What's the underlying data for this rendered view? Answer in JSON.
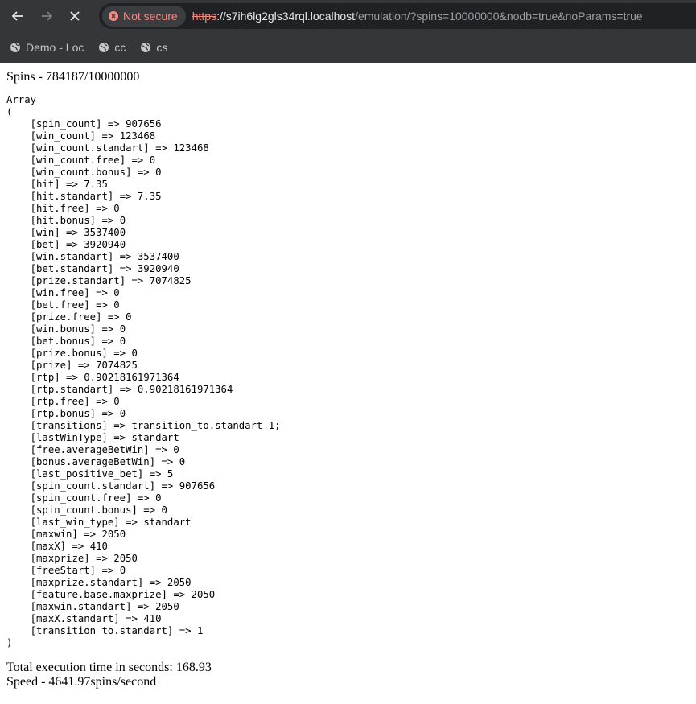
{
  "browser": {
    "security_label": "Not secure",
    "url_scheme": "https",
    "url_host": "://s7ih6lg2gls34rql.localhost",
    "url_path": "/emulation/?spins=10000000&nodb=true&noParams=true",
    "bookmarks": [
      {
        "label": "Demo - Loc",
        "icon": "globe-icon"
      },
      {
        "label": "cc",
        "icon": "globe-icon"
      },
      {
        "label": "cs",
        "icon": "globe-icon"
      }
    ]
  },
  "page": {
    "spins_line": "Spins - 784187/10000000",
    "array_open": "Array",
    "paren_open": "(",
    "entries": [
      {
        "key": "spin_count",
        "value": "907656"
      },
      {
        "key": "win_count",
        "value": "123468"
      },
      {
        "key": "win_count.standart",
        "value": "123468"
      },
      {
        "key": "win_count.free",
        "value": "0"
      },
      {
        "key": "win_count.bonus",
        "value": "0"
      },
      {
        "key": "hit",
        "value": "7.35"
      },
      {
        "key": "hit.standart",
        "value": "7.35"
      },
      {
        "key": "hit.free",
        "value": "0"
      },
      {
        "key": "hit.bonus",
        "value": "0"
      },
      {
        "key": "win",
        "value": "3537400"
      },
      {
        "key": "bet",
        "value": "3920940"
      },
      {
        "key": "win.standart",
        "value": "3537400"
      },
      {
        "key": "bet.standart",
        "value": "3920940"
      },
      {
        "key": "prize.standart",
        "value": "7074825"
      },
      {
        "key": "win.free",
        "value": "0"
      },
      {
        "key": "bet.free",
        "value": "0"
      },
      {
        "key": "prize.free",
        "value": "0"
      },
      {
        "key": "win.bonus",
        "value": "0"
      },
      {
        "key": "bet.bonus",
        "value": "0"
      },
      {
        "key": "prize.bonus",
        "value": "0"
      },
      {
        "key": "prize",
        "value": "7074825"
      },
      {
        "key": "rtp",
        "value": "0.90218161971364"
      },
      {
        "key": "rtp.standart",
        "value": "0.90218161971364"
      },
      {
        "key": "rtp.free",
        "value": "0"
      },
      {
        "key": "rtp.bonus",
        "value": "0"
      },
      {
        "key": "transitions",
        "value": "transition_to.standart-1;"
      },
      {
        "key": "lastWinType",
        "value": "standart"
      },
      {
        "key": "free.averageBetWin",
        "value": "0"
      },
      {
        "key": "bonus.averageBetWin",
        "value": "0"
      },
      {
        "key": "last_positive_bet",
        "value": "5"
      },
      {
        "key": "spin_count.standart",
        "value": "907656"
      },
      {
        "key": "spin_count.free",
        "value": "0"
      },
      {
        "key": "spin_count.bonus",
        "value": "0"
      },
      {
        "key": "last_win_type",
        "value": "standart"
      },
      {
        "key": "maxwin",
        "value": "2050"
      },
      {
        "key": "maxX",
        "value": "410"
      },
      {
        "key": "maxprize",
        "value": "2050"
      },
      {
        "key": "freeStart",
        "value": "0"
      },
      {
        "key": "maxprize.standart",
        "value": "2050"
      },
      {
        "key": "feature.base.maxprize",
        "value": "2050"
      },
      {
        "key": "maxwin.standart",
        "value": "2050"
      },
      {
        "key": "maxX.standart",
        "value": "410"
      },
      {
        "key": "transition_to.standart",
        "value": "1"
      }
    ],
    "paren_close": ")",
    "execution_time": "Total execution time in seconds: 168.93",
    "speed": "Speed - 4641.97spins/second"
  }
}
